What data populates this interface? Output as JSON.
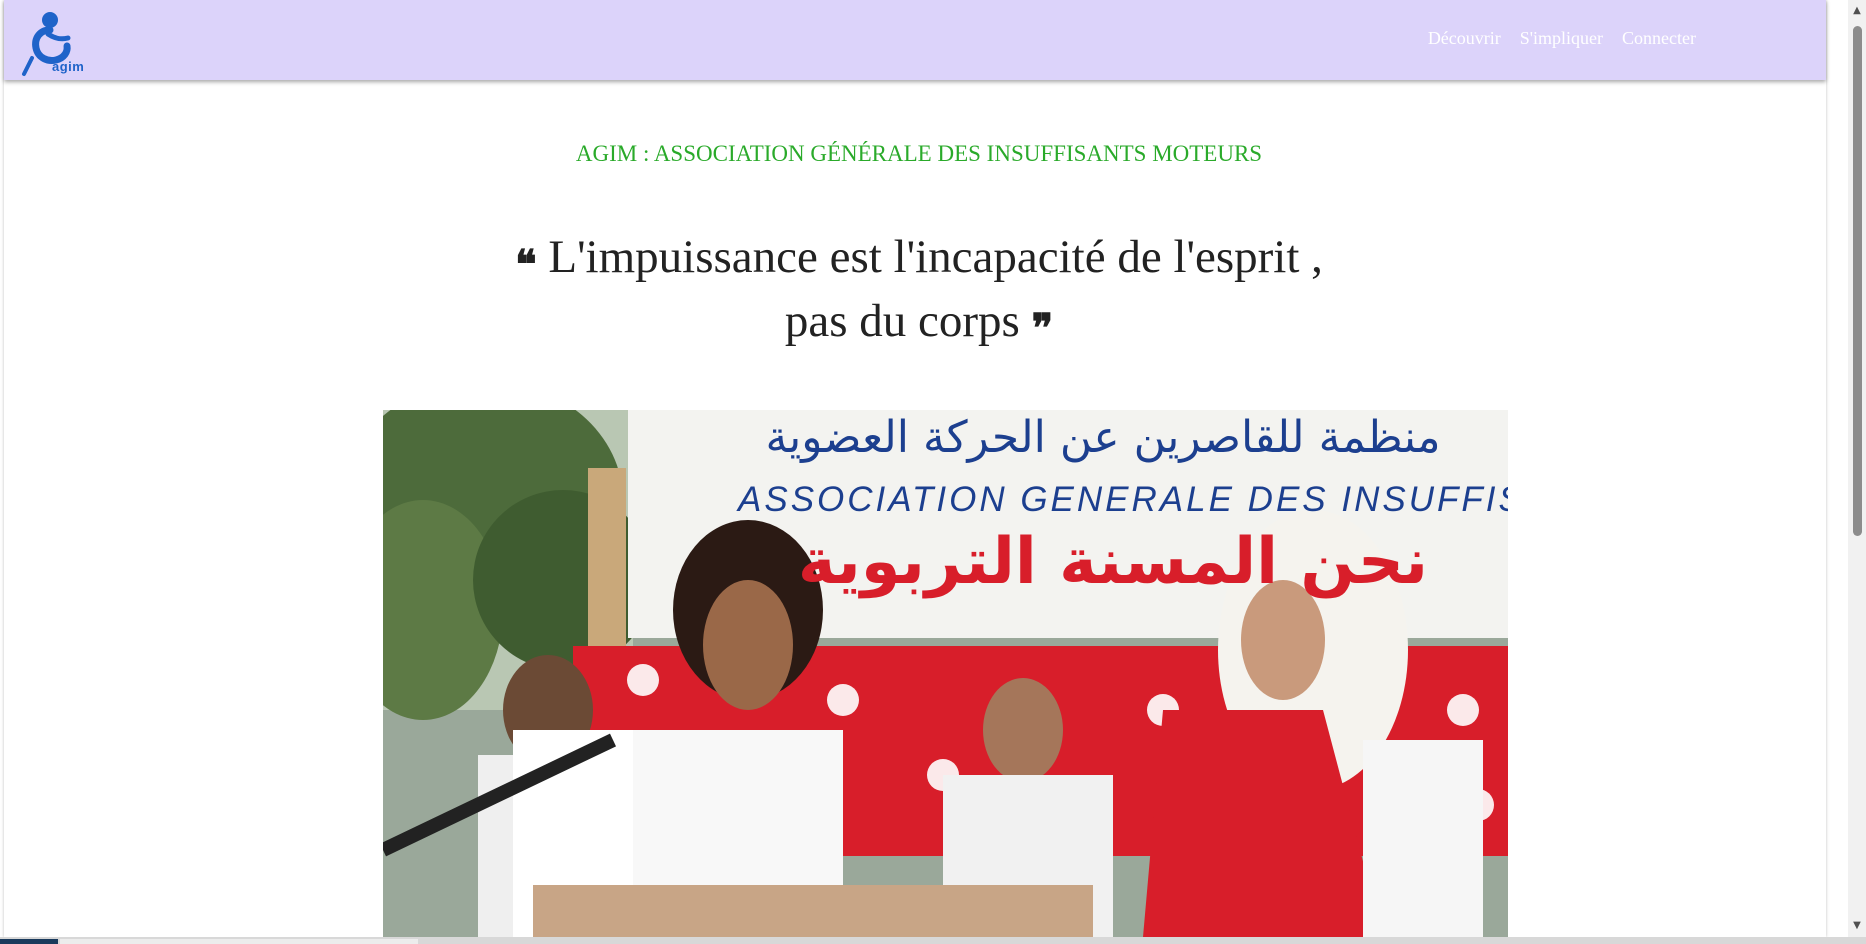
{
  "header": {
    "logo_text": "agim",
    "nav": [
      {
        "label": "Découvrir"
      },
      {
        "label": "S'impliquer"
      },
      {
        "label": "Connecter"
      }
    ]
  },
  "main": {
    "org_title": "AGIM : ASSOCIATION GÉNÉRALE DES INSUFFISANTS MOTEURS",
    "quote_open": "❝",
    "quote_line1": "L'impuissance est l'incapacité de l'esprit ,",
    "quote_line2": "pas du corps",
    "quote_close": "❞",
    "photo_banner": {
      "arabic_top": "منظمة للقاصرين عن الحركة العضوية",
      "latin": "ASSOCIATION GENERALE DES INSUFFISANTS",
      "arabic_red": "نحن المسنة التربوية"
    }
  },
  "colors": {
    "navbar_bg": "#dcd3fa",
    "title_green": "#2aaa2a",
    "logo_blue": "#1f63c9",
    "banner_blue": "#1c3f8f",
    "banner_red": "#d81e2a"
  },
  "icons": {
    "logo": "wheelchair-person-icon",
    "scroll_up": "chevron-up-icon",
    "scroll_down": "chevron-down-icon"
  }
}
